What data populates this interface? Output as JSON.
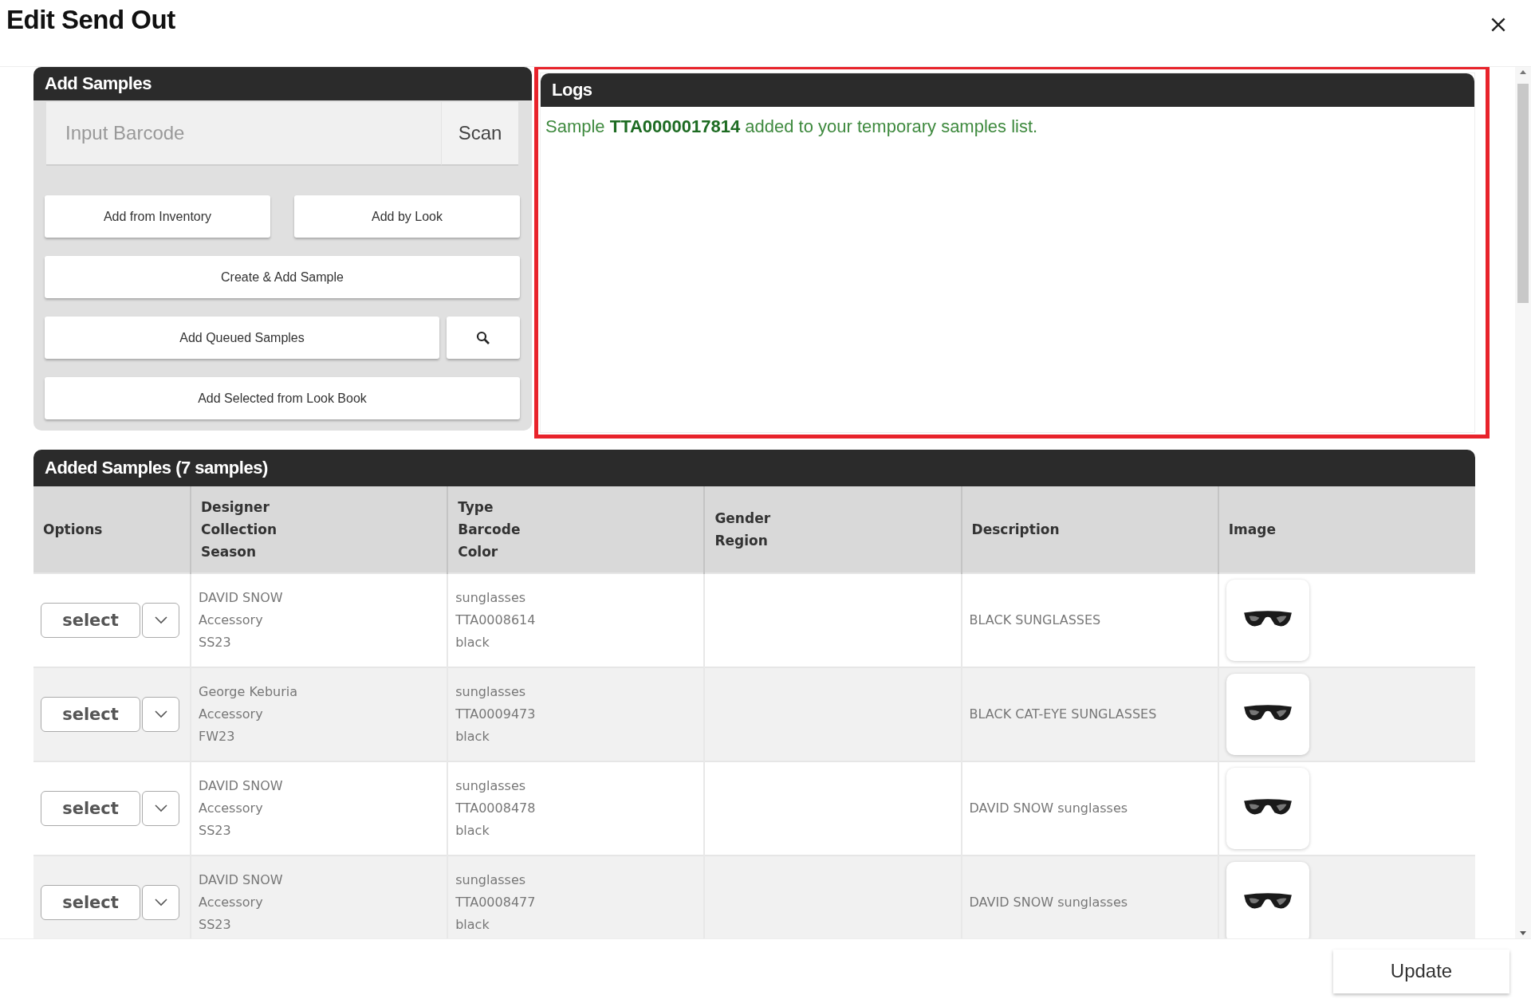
{
  "window": {
    "title": "Edit Send Out"
  },
  "add_samples": {
    "title": "Add Samples",
    "barcode": {
      "placeholder": "Input Barcode"
    },
    "scan_button": "Scan",
    "buttons": [
      "Add from Inventory",
      "Add by Look",
      "Create & Add Sample",
      "Add Queued Samples",
      "Add Selected from Look Book"
    ]
  },
  "logs": {
    "title": "Logs",
    "highlighted": true,
    "messages": [
      "Sample **TTA0000017814** added to your temporary samples list."
    ]
  },
  "added_samples": {
    "title": "Added Samples (7 samples)",
    "columns": [
      "Options",
      "Designer\nCollection\nSeason",
      "Type\nBarcode\nColor",
      "Gender\nRegion",
      "Description",
      "Image"
    ],
    "rows": [
      {
        "option": "select",
        "designer": "DAVID SNOW\nAccessory\nSS23",
        "type": "sunglasses\nTTA0008614\nblack",
        "gender": "",
        "description": "BLACK SUNGLASSES"
      },
      {
        "option": "select",
        "designer": "George Keburia\nAccessory\nFW23",
        "type": "sunglasses\nTTA0009473\nblack",
        "gender": "",
        "description": "BLACK CAT-EYE SUNGLASSES"
      },
      {
        "option": "select",
        "designer": "DAVID SNOW\nAccessory\nSS23",
        "type": "sunglasses\nTTA0008478\nblack",
        "gender": "",
        "description": "DAVID SNOW sunglasses"
      },
      {
        "option": "select",
        "designer": "DAVID SNOW\nAccessory\nSS23",
        "type": "sunglasses\nTTA0008477\nblack",
        "gender": "",
        "description": "DAVID SNOW sunglasses"
      }
    ]
  },
  "footer": {
    "update_button": "Update"
  }
}
